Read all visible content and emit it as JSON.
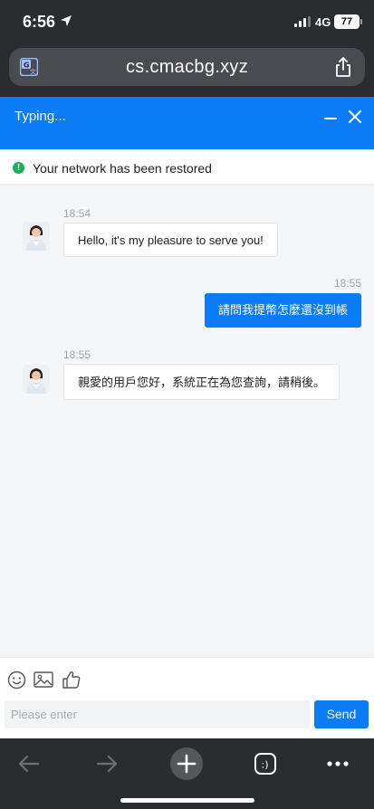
{
  "status_bar": {
    "time": "6:56",
    "network": "4G",
    "battery": "77"
  },
  "browser": {
    "url": "cs.cmacbg.xyz"
  },
  "chat_header": {
    "status": "Typing..."
  },
  "notice": {
    "text": "Your network has been restored"
  },
  "messages": [
    {
      "from": "agent",
      "time": "18:54",
      "text": "Hello, it's my pleasure to serve you!"
    },
    {
      "from": "user",
      "time": "18:55",
      "text": "請問我提幣怎麼還沒到帳"
    },
    {
      "from": "agent",
      "time": "18:55",
      "text": "親愛的用戶您好，系統正在為您查詢，請稍後。"
    }
  ],
  "composer": {
    "placeholder": "Please enter",
    "send_label": "Send",
    "tools": [
      "smiley-icon",
      "image-icon",
      "thumbs-up-icon"
    ]
  },
  "toolbar": {
    "items": [
      "back-icon",
      "forward-icon",
      "new-tab-icon",
      "extension-icon",
      "more-icon"
    ]
  },
  "colors": {
    "accent": "#0b7cf6",
    "success": "#1aaf5d"
  }
}
